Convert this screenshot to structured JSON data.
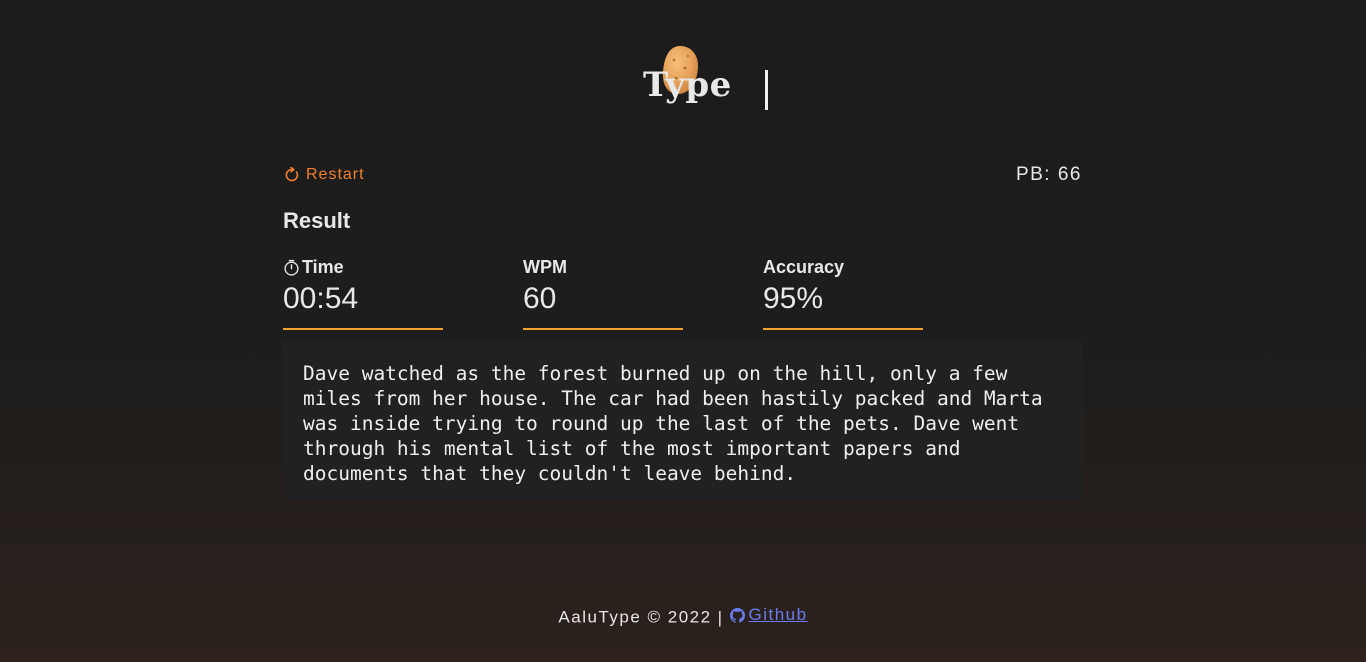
{
  "logo": {
    "word": "Type",
    "icon": "potato-icon"
  },
  "controls": {
    "restart_label": "Restart",
    "restart_icon": "refresh-icon",
    "pb_text": "PB: 66",
    "accent_color": "#f47f2b"
  },
  "result": {
    "title": "Result",
    "stats": [
      {
        "label": "Time",
        "value": "00:54",
        "icon": "stopwatch-icon"
      },
      {
        "label": "WPM",
        "value": "60"
      },
      {
        "label": "Accuracy",
        "value": "95%"
      }
    ],
    "underline_color": "#f2a12b"
  },
  "passage": {
    "lines": [
      "Dave watched as the forest burned up on the hill, only a few",
      "miles from her house. The car had been hastily packed and Marta",
      "was inside trying to round up the last of the pets. Dave went",
      "through his mental list of the most important papers and",
      "documents that they couldn't leave behind."
    ]
  },
  "footer": {
    "copyright": "AaluType © 2022",
    "separator": "|",
    "github_label": "Github",
    "github_icon": "github-icon",
    "link_color": "#6a7cf0"
  }
}
